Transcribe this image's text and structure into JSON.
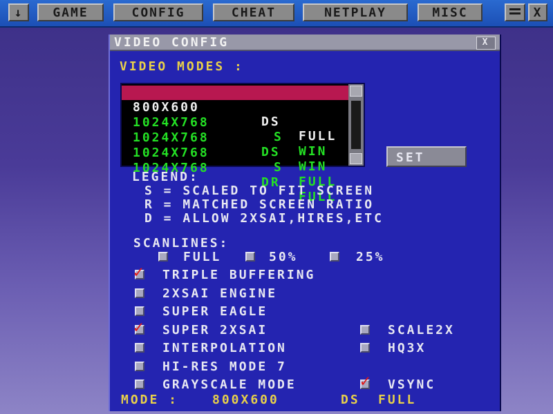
{
  "topbar": {
    "arrow_icon": "down-arrow-icon",
    "menus": [
      {
        "id": "game",
        "label": "GAME"
      },
      {
        "id": "config",
        "label": "CONFIG"
      },
      {
        "id": "cheat",
        "label": "CHEAT"
      },
      {
        "id": "netplay",
        "label": "NETPLAY"
      },
      {
        "id": "misc",
        "label": "MISC"
      }
    ],
    "minimize_icon": "minimize-icon",
    "close_label": "X"
  },
  "window": {
    "title": "VIDEO CONFIG",
    "close_label": "X",
    "video_modes_label": "VIDEO MODES :",
    "modes": [
      {
        "res": "800X600",
        "flags": "DS",
        "mode": "FULL",
        "selected": true
      },
      {
        "res": "1024X768",
        "flags": "S",
        "mode": "WIN",
        "selected": false
      },
      {
        "res": "1024X768",
        "flags": "DS",
        "mode": "WIN",
        "selected": false
      },
      {
        "res": "1024X768",
        "flags": "S",
        "mode": "FULL",
        "selected": false
      },
      {
        "res": "1024X768",
        "flags": "DR",
        "mode": "FULL",
        "selected": false
      }
    ],
    "set_label": "SET",
    "legend_title": "LEGEND:",
    "legend_lines": [
      "S = SCALED TO FIT SCREEN",
      "R = MATCHED SCREEN RATIO",
      "D = ALLOW 2XSAI,HIRES,ETC"
    ],
    "scanlines_label": "SCANLINES:",
    "scanlines": [
      "FULL",
      "50%",
      "25%"
    ],
    "options": {
      "triple_buffering": {
        "label": "TRIPLE BUFFERING",
        "checked": true
      },
      "twoxsai_engine": {
        "label": "2XSAI ENGINE",
        "checked": false
      },
      "super_eagle": {
        "label": "SUPER EAGLE",
        "checked": false
      },
      "super_2xsai": {
        "label": "SUPER 2XSAI",
        "checked": true
      },
      "scale2x": {
        "label": "SCALE2X",
        "checked": false
      },
      "interpolation": {
        "label": "INTERPOLATION",
        "checked": false
      },
      "hq3x": {
        "label": "HQ3X",
        "checked": false
      },
      "hires_mode7": {
        "label": "HI-RES MODE 7",
        "checked": false
      },
      "grayscale": {
        "label": "GRAYSCALE MODE",
        "checked": false
      },
      "vsync": {
        "label": "VSYNC",
        "checked": true
      }
    },
    "status": {
      "prefix": "MODE :",
      "res": "800X600",
      "flags": "DS",
      "mode": "FULL"
    }
  }
}
